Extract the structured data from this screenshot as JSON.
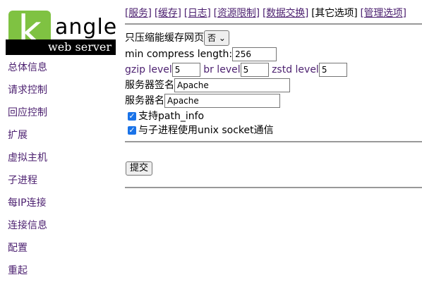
{
  "logo": {
    "letter": "k",
    "word": "angle",
    "tagline": "web server",
    "accent_color": "#7fc242"
  },
  "sidebar": {
    "items": [
      {
        "label": "总体信息"
      },
      {
        "label": "请求控制"
      },
      {
        "label": "回应控制"
      },
      {
        "label": "扩展"
      },
      {
        "label": "虚拟主机"
      },
      {
        "label": "子进程"
      },
      {
        "label": "每IP连接"
      },
      {
        "label": "连接信息"
      },
      {
        "label": "配置"
      },
      {
        "label": "重起"
      }
    ]
  },
  "topnav": {
    "items": [
      {
        "label": "[服务]",
        "link": true
      },
      {
        "label": "[缓存]",
        "link": true
      },
      {
        "label": "[日志]",
        "link": true
      },
      {
        "label": "[资源限制]",
        "link": true
      },
      {
        "label": "[数据交换]",
        "link": true
      },
      {
        "label": "[其它选项]",
        "link": false
      },
      {
        "label": "[管理选项]",
        "link": true
      }
    ]
  },
  "form": {
    "only_compress_cached_label": "只压缩能缓存网页",
    "only_compress_cached_value": "否",
    "min_compress_length_label": "min compress length:",
    "min_compress_length_value": "256",
    "gzip_level_label": "gzip level",
    "gzip_level_value": "5",
    "br_level_label": "br level",
    "br_level_value": "5",
    "zstd_level_label": "zstd level",
    "zstd_level_value": "5",
    "server_signature_label": "服务器签名",
    "server_signature_value": "Apache",
    "server_name_label": "服务器名",
    "server_name_value": "Apache",
    "path_info_label": "支持path_info",
    "path_info_checked": true,
    "unix_socket_label": "与子进程使用unix socket通信",
    "unix_socket_checked": true
  },
  "submit_label": "提交"
}
